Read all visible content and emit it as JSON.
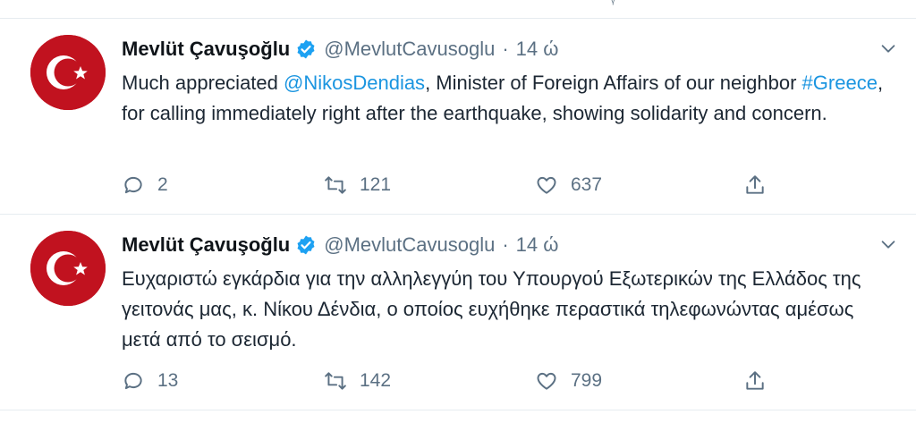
{
  "top_partial": {
    "glyph": "ᵞ"
  },
  "tweets": [
    {
      "author_name": "Mevlüt Çavuşoğlu",
      "handle": "@MevlutCavusoglu",
      "separator": "·",
      "time": "14 ώ",
      "text": {
        "p1": "Much appreciated ",
        "mention": "@NikosDendias",
        "p2": ", Minister of Foreign Affairs of our neighbor ",
        "hashtag": "#Greece",
        "p3": ", for calling immediately right after the earthquake, showing solidarity and concern."
      },
      "reply_count": "2",
      "retweet_count": "121",
      "like_count": "637"
    },
    {
      "author_name": "Mevlüt Çavuşoğlu",
      "handle": "@MevlutCavusoglu",
      "separator": "·",
      "time": "14 ώ",
      "text": {
        "p1": "Ευχαριστώ εγκάρδια για την αλληλεγγύη του Υπουργού Εξωτερικών της Ελλάδος της γειτονάς μας, κ. Νίκου Δένδια, ο οποίος ευχήθηκε περαστικά τηλεφωνώντας αμέσως μετά από το σεισμό."
      },
      "reply_count": "13",
      "retweet_count": "142",
      "like_count": "799"
    }
  ],
  "icons": {
    "avatar": "turkish-flag",
    "verified": "verified-badge-icon",
    "caret": "chevron-down-icon",
    "reply": "reply-icon",
    "retweet": "retweet-icon",
    "like": "heart-icon",
    "share": "share-icon"
  },
  "colors": {
    "link": "#1b95e0",
    "verified": "#1da1f2",
    "muted": "#5b7083",
    "flag_red": "#c1121f"
  }
}
